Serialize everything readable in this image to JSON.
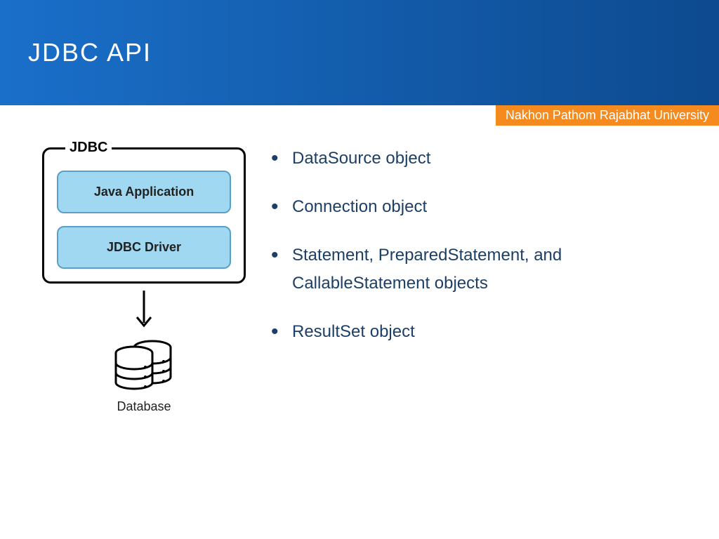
{
  "header": {
    "title": "JDBC API"
  },
  "banner": {
    "text": "Nakhon Pathom Rajabhat University"
  },
  "diagram": {
    "group_label": "JDBC",
    "box1": "Java Application",
    "box2": "JDBC Driver",
    "db_label": "Database"
  },
  "bullets": {
    "items": [
      "DataSource object",
      "Connection object",
      "Statement, PreparedStatement, and CallableStatement objects",
      "ResultSet object"
    ]
  }
}
